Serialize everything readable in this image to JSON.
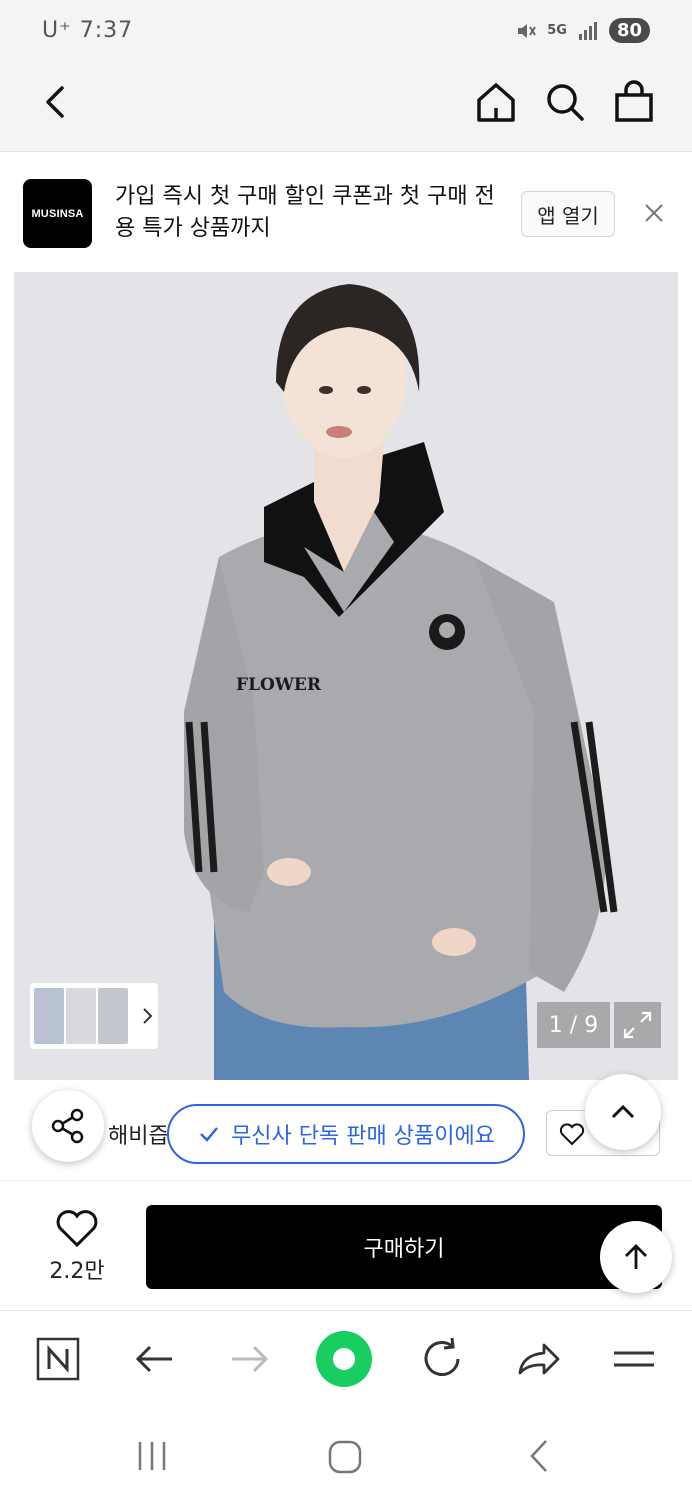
{
  "status_bar": {
    "carrier": "U⁺",
    "time": "7:37",
    "network": "5G",
    "battery": "80"
  },
  "banner": {
    "logo_text": "MUSINSA",
    "message": "가입 즉시 첫 구매 할인 쿠폰과 첫 구매 전용 특가 상품까지",
    "open_app_label": "앱 열기"
  },
  "gallery": {
    "counter": "1 / 9",
    "product_print": "FLOWER"
  },
  "product": {
    "brand_partial": "해비즙",
    "exclusive_label": "무신사 단독 판매 상품이에요"
  },
  "purchase": {
    "like_count": "2.2만",
    "buy_label": "구매하기"
  },
  "colors": {
    "accent_blue": "#2d64e6",
    "buy_button": "#000000",
    "naver_green": "#19ce60"
  }
}
